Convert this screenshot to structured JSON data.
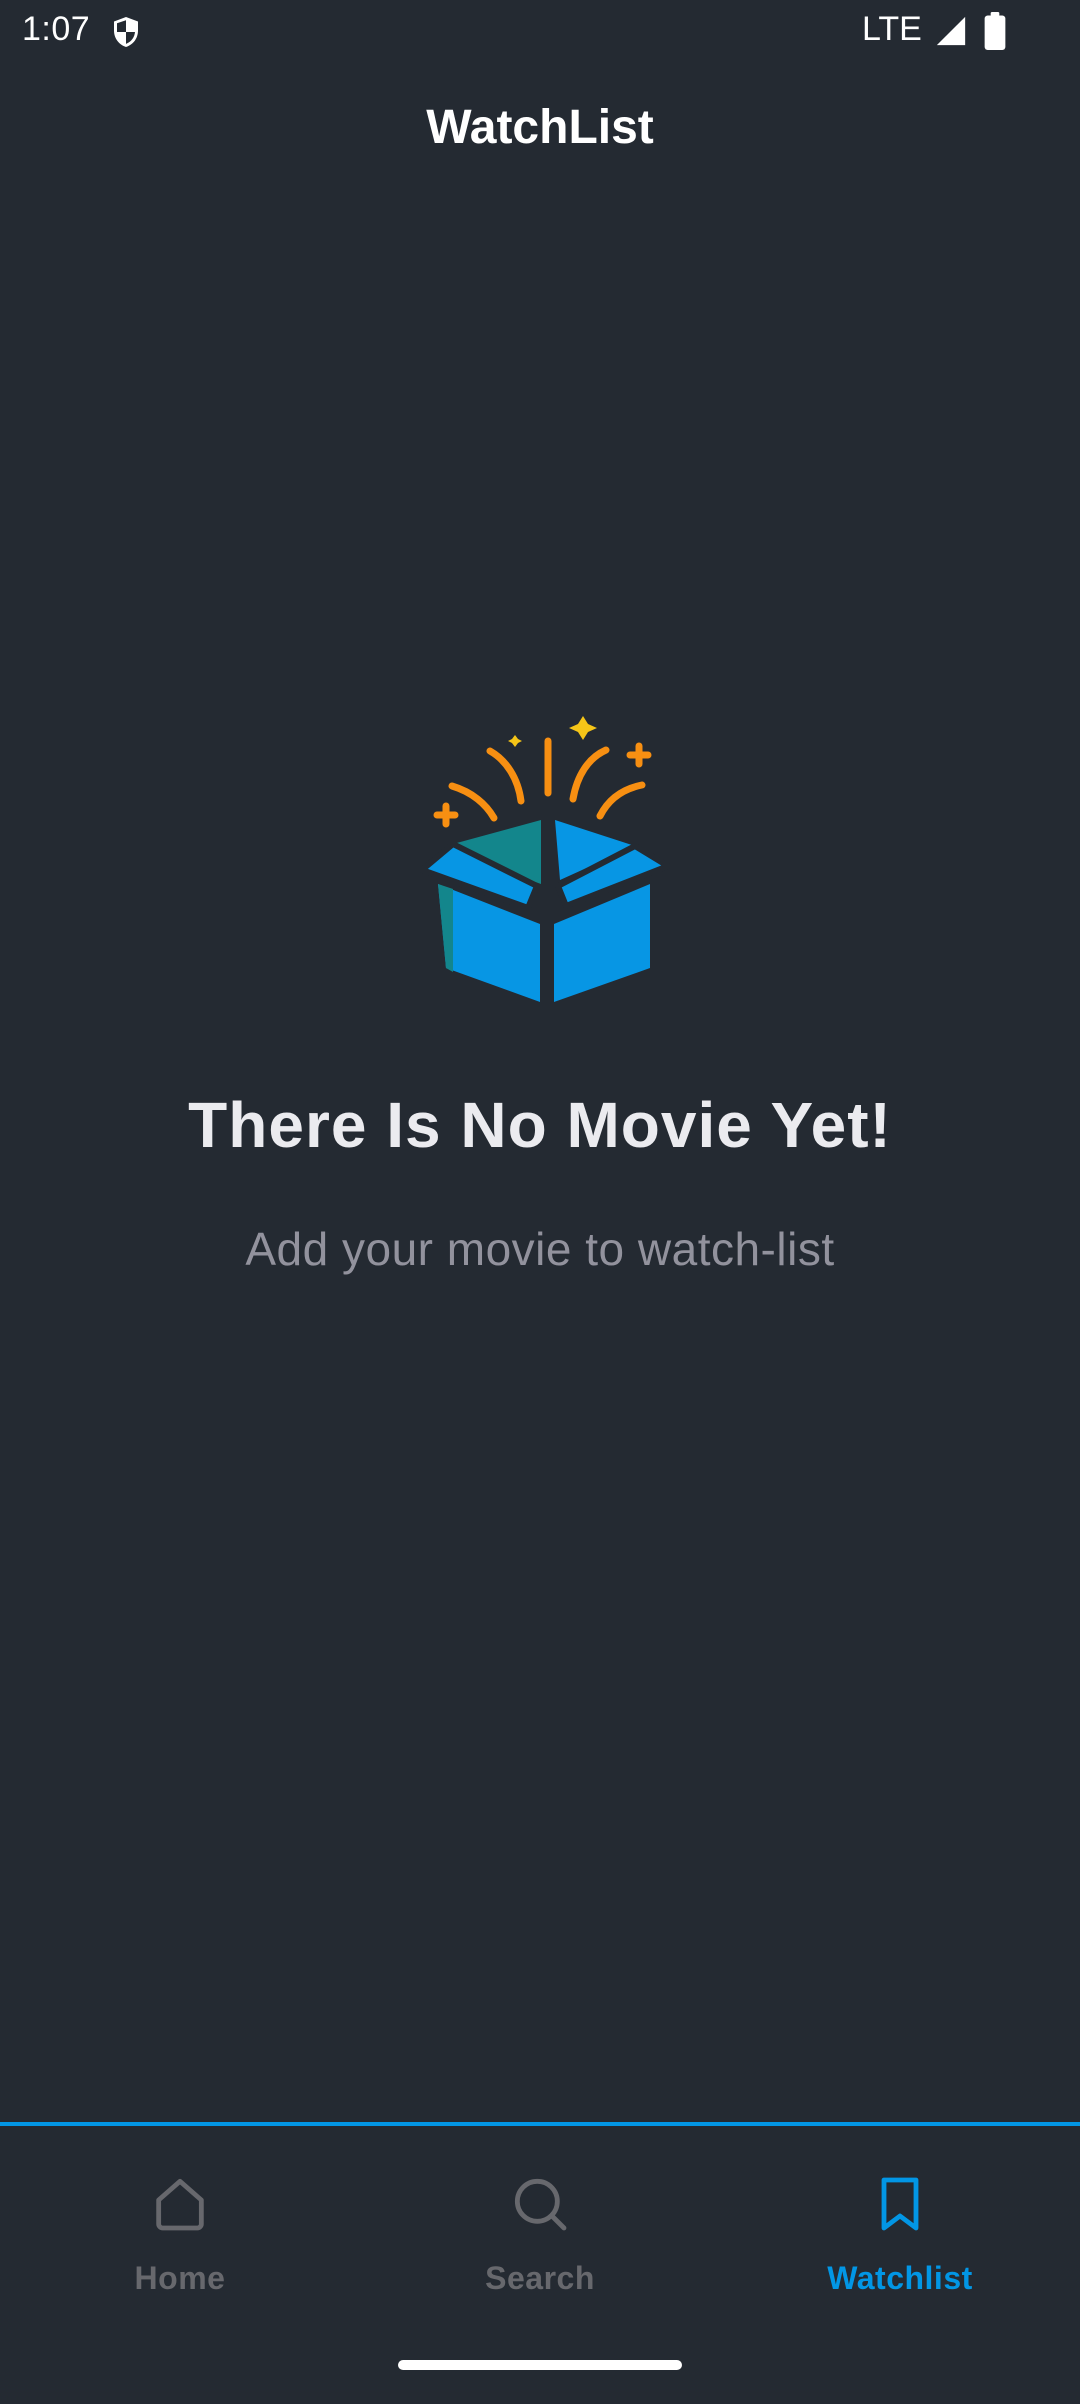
{
  "status_bar": {
    "time": "1:07",
    "network": "LTE",
    "icons": [
      "shield-icon",
      "signal-icon",
      "battery-icon"
    ]
  },
  "header": {
    "title": "WatchList"
  },
  "empty_state": {
    "icon": "open-box-icon",
    "title": "There Is No Movie Yet!",
    "subtitle": "Add your movie to watch-list"
  },
  "bottom_nav": {
    "items": [
      {
        "label": "Home",
        "icon": "home-icon",
        "active": false
      },
      {
        "label": "Search",
        "icon": "search-icon",
        "active": false
      },
      {
        "label": "Watchlist",
        "icon": "bookmark-icon",
        "active": true
      }
    ]
  },
  "colors": {
    "background": "#242A32",
    "accent": "#0296E5",
    "inactive": "#67686D",
    "subtitle": "#92929D"
  }
}
